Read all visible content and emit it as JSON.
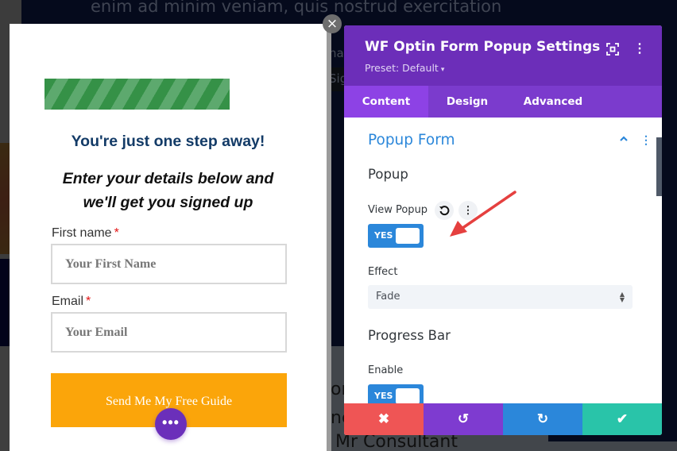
{
  "background": {
    "headline": "enim ad minim veniam, quis nostrud exercitation",
    "fragments": [
      "nat",
      "Sig",
      "or",
      "nc",
      "Mr Consultant"
    ]
  },
  "popup": {
    "close_icon": "×",
    "progress": {
      "label": "progress-bar",
      "value_percent": 100
    },
    "heading": "You're just one step away!",
    "subheading_line1": "Enter your details below and",
    "subheading_line2": "we'll get you signed up",
    "fields": [
      {
        "label": "First name",
        "required_mark": "*",
        "placeholder": "Your First Name",
        "value": ""
      },
      {
        "label": "Email",
        "required_mark": "*",
        "placeholder": "Your Email",
        "value": ""
      }
    ],
    "submit_label": "Send Me My Free Guide",
    "fab_icon": "•••"
  },
  "panel": {
    "title": "WF Optin Form Popup Settings",
    "preset": "Preset: Default",
    "preset_caret": "▾",
    "more_icon": "⋮",
    "tabs": [
      {
        "label": "Content",
        "active": true
      },
      {
        "label": "Design",
        "active": false
      },
      {
        "label": "Advanced",
        "active": false
      }
    ],
    "section": {
      "title": "Popup Form",
      "chevron_icon": "^",
      "more_icon": "⋮"
    },
    "groups": {
      "popup": {
        "title": "Popup",
        "view_popup": {
          "label": "View Popup",
          "reset_icon": "↺",
          "more_icon": "⋮",
          "value": "YES"
        },
        "effect": {
          "label": "Effect",
          "value": "Fade"
        }
      },
      "progress_bar": {
        "title": "Progress Bar",
        "enable": {
          "label": "Enable",
          "value": "YES"
        }
      }
    },
    "footer": {
      "cancel_icon": "✖",
      "undo_icon": "↺",
      "redo_icon": "↻",
      "save_icon": "✔"
    }
  },
  "colors": {
    "panel_purple": "#6c2eb9",
    "tab_active": "#8d42e5",
    "accent_blue": "#2b87da",
    "cancel_red": "#ef5555",
    "save_teal": "#29c4a9",
    "submit_orange": "#fba50a",
    "progress_green": "#359147",
    "heading_navy": "#133b67",
    "annotation_arrow": "#e5403f"
  }
}
